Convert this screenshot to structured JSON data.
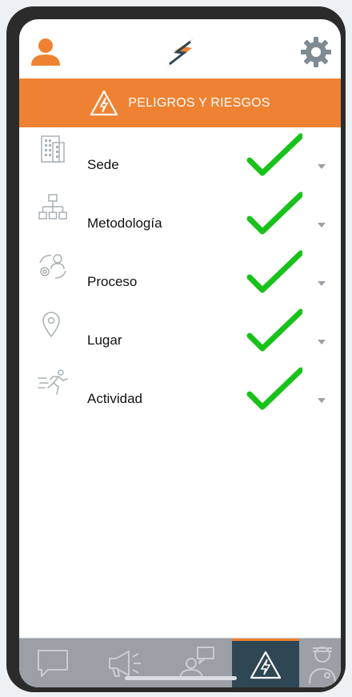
{
  "header": {
    "banner_title": "PELIGROS Y RIESGOS"
  },
  "rows": [
    {
      "label": "Sede",
      "icon": "building-icon",
      "checked": true
    },
    {
      "label": "Metodología",
      "icon": "hierarchy-icon",
      "checked": true
    },
    {
      "label": "Proceso",
      "icon": "process-cycle-icon",
      "checked": true
    },
    {
      "label": "Lugar",
      "icon": "location-pin-icon",
      "checked": true
    },
    {
      "label": "Actividad",
      "icon": "running-person-icon",
      "checked": true
    }
  ],
  "bottom_nav": {
    "items": [
      {
        "icon": "chat-bubble-icon",
        "active": false
      },
      {
        "icon": "megaphone-icon",
        "active": false
      },
      {
        "icon": "person-speech-icon",
        "active": false
      },
      {
        "icon": "warning-triangle-icon",
        "active": true
      },
      {
        "icon": "doctor-icon",
        "active": false
      }
    ]
  },
  "colors": {
    "accent": "#ef8232",
    "check": "#19c21a",
    "nav_bg": "#9aa0a6",
    "nav_active": "#2f4654"
  }
}
